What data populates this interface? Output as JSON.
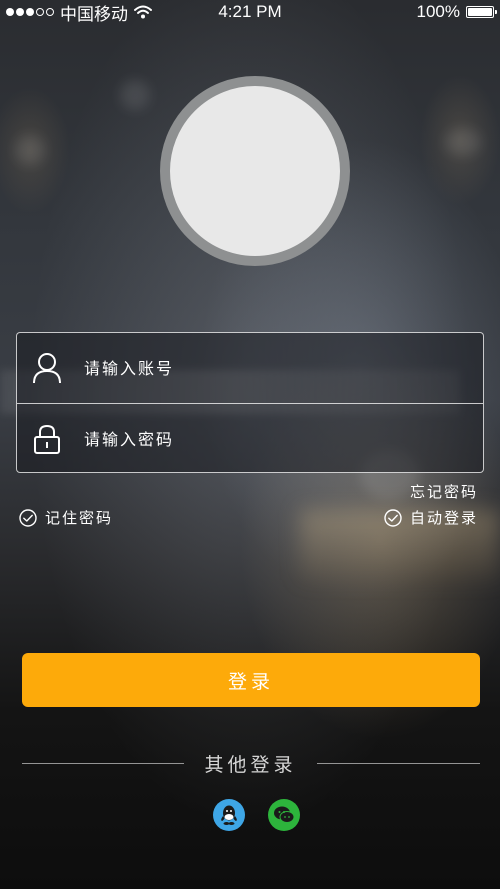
{
  "status_bar": {
    "carrier": "中国移动",
    "time": "4:21 PM",
    "battery_text": "100%",
    "battery_level": 1.0,
    "signal_bars_filled": 3,
    "signal_bars_total": 5
  },
  "form": {
    "username_placeholder": "请输入账号",
    "password_placeholder": "请输入密码"
  },
  "options": {
    "forgot_password": "忘记密码",
    "remember_password": "记住密码",
    "auto_login": "自动登录"
  },
  "login_button_label": "登录",
  "other_login": {
    "label": "其他登录",
    "providers": [
      "qq-icon",
      "wechat-icon"
    ]
  },
  "colors": {
    "accent": "#fdaa0a",
    "qq": "#3ea6e6",
    "wechat": "#2db43c",
    "avatar_fill": "#e8e8e8",
    "avatar_ring": "#8e9091"
  }
}
